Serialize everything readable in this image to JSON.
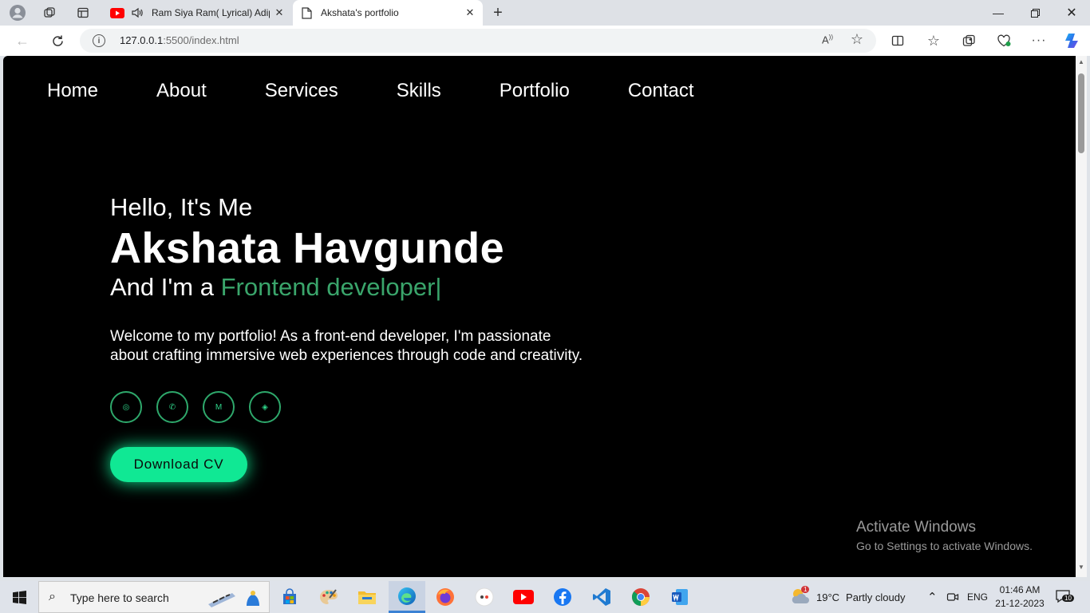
{
  "browser": {
    "tabs": [
      {
        "title": "Ram Siya Ram( Lyrical) Adip",
        "icon": "youtube-icon",
        "audio": "speaker-icon",
        "active": false
      },
      {
        "title": "Akshata's portfolio",
        "icon": "page-icon",
        "active": true
      }
    ],
    "url": {
      "host": "127.0.0.1",
      "path": ":5500/index.html"
    }
  },
  "site": {
    "nav": [
      "Home",
      "About",
      "Services",
      "Skills",
      "Portfolio",
      "Contact"
    ],
    "hero": {
      "greeting": "Hello, It's Me",
      "name": "Akshata Havgunde",
      "role_prefix": "And I'm a ",
      "role": "Frontend developer|",
      "description": "Welcome to my portfolio! As a front-end developer, I'm passionate about crafting immersive web experiences through code and creativity.",
      "socials": [
        {
          "name": "instagram-icon",
          "glyph": "◎"
        },
        {
          "name": "whatsapp-icon",
          "glyph": "✆"
        },
        {
          "name": "gmail-icon",
          "glyph": "M"
        },
        {
          "name": "link-icon",
          "glyph": "◈"
        }
      ],
      "cta": "Download CV"
    },
    "accent_color": "#3aa56b",
    "button_color": "#10e894"
  },
  "watermark": {
    "line1": "Activate Windows",
    "line2": "Go to Settings to activate Windows."
  },
  "taskbar": {
    "search_placeholder": "Type here to search",
    "weather": {
      "temp": "19°C",
      "desc": "Partly cloudy",
      "badge": "1"
    },
    "lang": "ENG",
    "time": "01:46 AM",
    "date": "21-12-2023",
    "notifications": "10"
  }
}
